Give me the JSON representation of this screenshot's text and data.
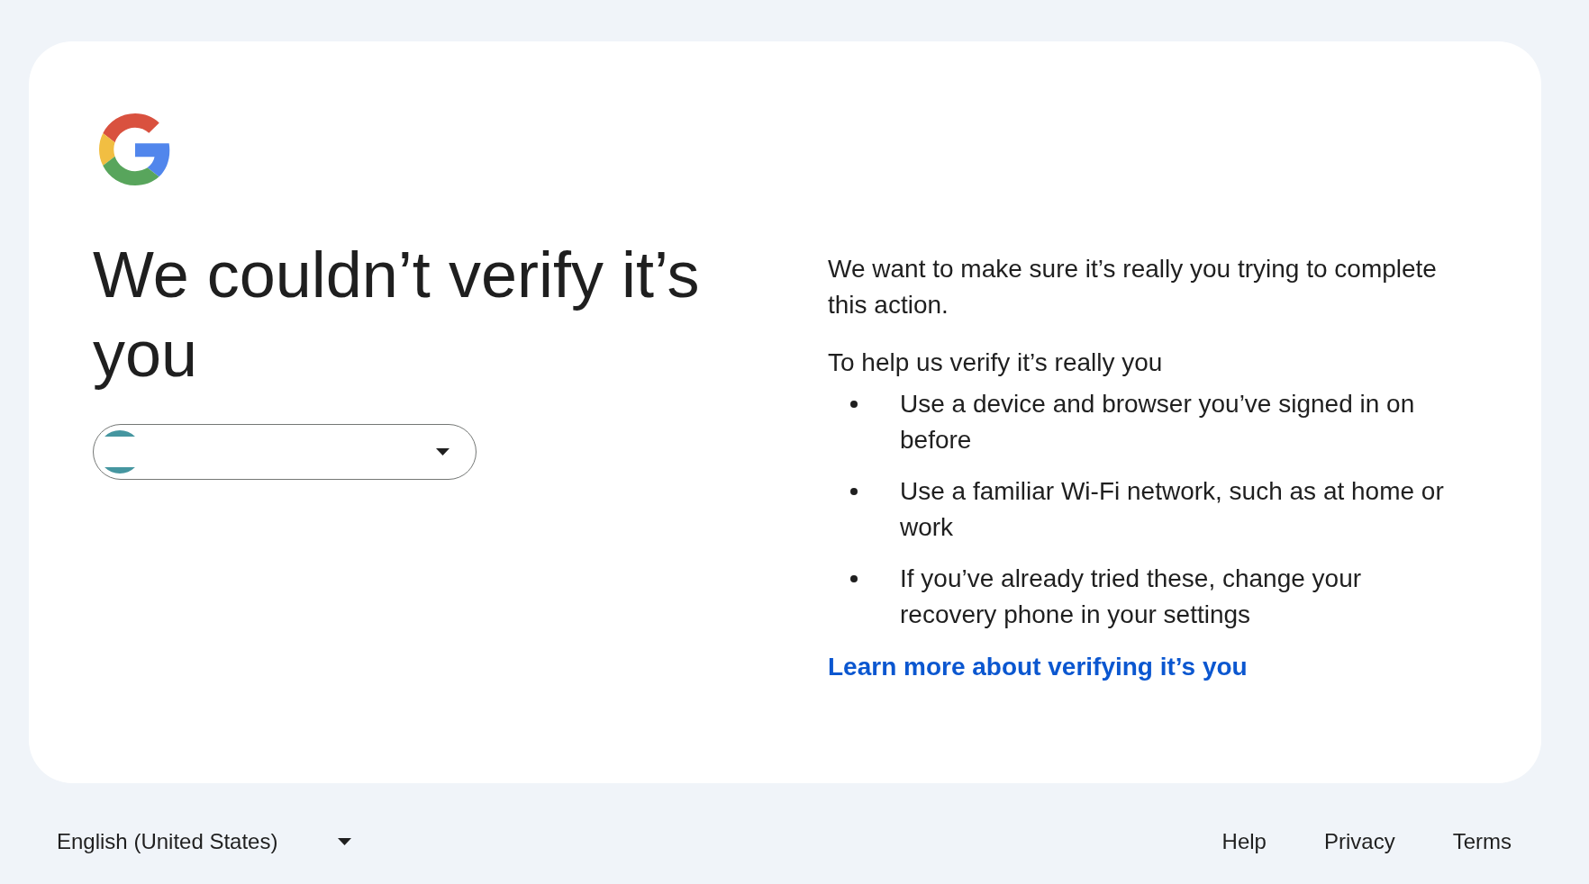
{
  "heading": "We couldn’t verify it’s you",
  "intro": "We want to make sure it’s really you trying to complete this action.",
  "tips_heading": "To help us verify it’s really you",
  "tips": [
    "Use a device and browser you’ve signed in on before",
    "Use a familiar Wi-Fi network, such as at home or work",
    "If you’ve already tried these, change your recovery phone in your settings"
  ],
  "learn_more_link": "Learn more about verifying it’s you",
  "footer": {
    "language": "English (United States)",
    "links": [
      "Help",
      "Privacy",
      "Terms"
    ]
  }
}
